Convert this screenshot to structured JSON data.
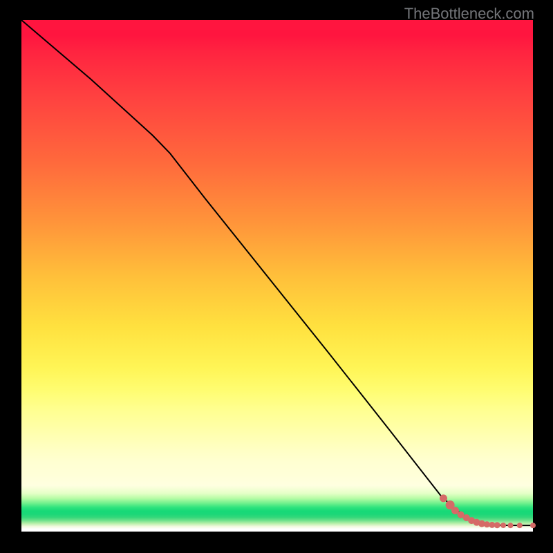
{
  "watermark": "TheBottleneck.com",
  "colors": {
    "line": "#000000",
    "marker_fill": "#d56a67",
    "marker_stroke": "#a94a47"
  },
  "chart_data": {
    "type": "line",
    "title": "",
    "xlabel": "",
    "ylabel": "",
    "xlim": [
      0,
      100
    ],
    "ylim": [
      0,
      100
    ],
    "grid": false,
    "series": [
      {
        "name": "curve",
        "x": [
          0.0,
          13.5,
          25.6,
          29.0,
          36.0,
          48.0,
          60.0,
          72.0,
          82.0,
          85.0,
          87.0,
          88.5,
          89.5,
          90.3,
          91.5,
          93.0,
          95.0,
          98.0,
          100.0
        ],
        "y": [
          100.0,
          88.5,
          77.5,
          74.0,
          65.0,
          50.0,
          35.0,
          19.8,
          7.0,
          4.2,
          2.8,
          2.0,
          1.6,
          1.4,
          1.3,
          1.25,
          1.22,
          1.2,
          1.2
        ]
      }
    ],
    "markers": [
      {
        "x": 82.5,
        "y": 6.5,
        "r": 5.5
      },
      {
        "x": 83.8,
        "y": 5.2,
        "r": 6.5
      },
      {
        "x": 84.8,
        "y": 4.1,
        "r": 5.5
      },
      {
        "x": 85.9,
        "y": 3.3,
        "r": 5.0
      },
      {
        "x": 87.0,
        "y": 2.7,
        "r": 5.0
      },
      {
        "x": 88.0,
        "y": 2.15,
        "r": 5.0
      },
      {
        "x": 89.0,
        "y": 1.8,
        "r": 5.0
      },
      {
        "x": 90.0,
        "y": 1.55,
        "r": 5.0
      },
      {
        "x": 91.0,
        "y": 1.4,
        "r": 4.5
      },
      {
        "x": 92.0,
        "y": 1.3,
        "r": 4.5
      },
      {
        "x": 93.0,
        "y": 1.25,
        "r": 4.5
      },
      {
        "x": 94.2,
        "y": 1.22,
        "r": 4.0
      },
      {
        "x": 95.6,
        "y": 1.2,
        "r": 4.0
      },
      {
        "x": 97.4,
        "y": 1.2,
        "r": 4.0
      },
      {
        "x": 100.0,
        "y": 1.2,
        "r": 4.0
      }
    ]
  }
}
